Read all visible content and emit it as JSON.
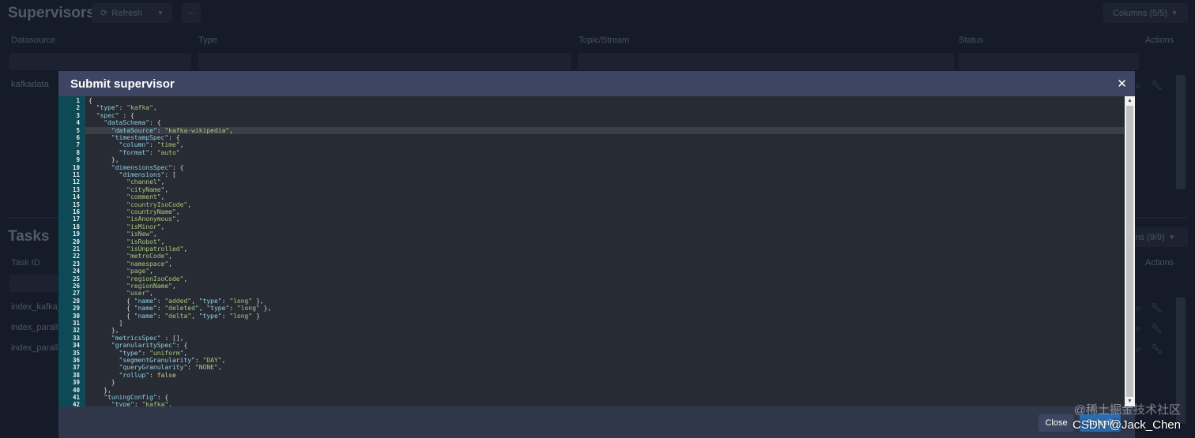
{
  "background": {
    "title": "Supervisors",
    "refresh_label": "Refresh",
    "columns_label": "Columns (5/5)",
    "columns": [
      "Datasource",
      "Type",
      "Topic/Stream",
      "Status",
      "Actions"
    ],
    "rows": [
      {
        "datasource": "kafkadata"
      }
    ],
    "tasks_title": "Tasks",
    "tasks_columns_label": "ns (9/9)",
    "tasks_columns": [
      "Task ID",
      "Actions"
    ],
    "task_rows": [
      "index_kafka_",
      "index_parall",
      "index_parall"
    ]
  },
  "modal": {
    "title": "Submit supervisor",
    "close_icon": "close-icon",
    "close_button": "Close",
    "submit_button": "Submit"
  },
  "editor": {
    "active_line": 5,
    "lines": [
      "{",
      "  \"type\": \"kafka\",",
      "  \"spec\" : {",
      "    \"dataSchema\": {",
      "      \"dataSource\": \"kafka-wikipedia\",",
      "      \"timestampSpec\": {",
      "        \"column\": \"time\",",
      "        \"format\": \"auto\"",
      "      },",
      "      \"dimensionsSpec\": {",
      "        \"dimensions\": [",
      "          \"channel\",",
      "          \"cityName\",",
      "          \"comment\",",
      "          \"countryIsoCode\",",
      "          \"countryName\",",
      "          \"isAnonymous\",",
      "          \"isMinor\",",
      "          \"isNew\",",
      "          \"isRobot\",",
      "          \"isUnpatrolled\",",
      "          \"metroCode\",",
      "          \"namespace\",",
      "          \"page\",",
      "          \"regionIsoCode\",",
      "          \"regionName\",",
      "          \"user\",",
      "          { \"name\": \"added\", \"type\": \"long\" },",
      "          { \"name\": \"deleted\", \"type\": \"long\" },",
      "          { \"name\": \"delta\", \"type\": \"long\" }",
      "        ]",
      "      },",
      "      \"metricsSpec\" : [],",
      "      \"granularitySpec\": {",
      "        \"type\": \"uniform\",",
      "        \"segmentGranularity\": \"DAY\",",
      "        \"queryGranularity\": \"NONE\",",
      "        \"rollup\": false",
      "      }",
      "    },",
      "    \"tuningConfig\": {",
      "      \"type\": \"kafka\","
    ]
  },
  "watermark": {
    "line1": "@稀土掘金技术社区",
    "line2": "CSDN @Jack_Chen"
  }
}
